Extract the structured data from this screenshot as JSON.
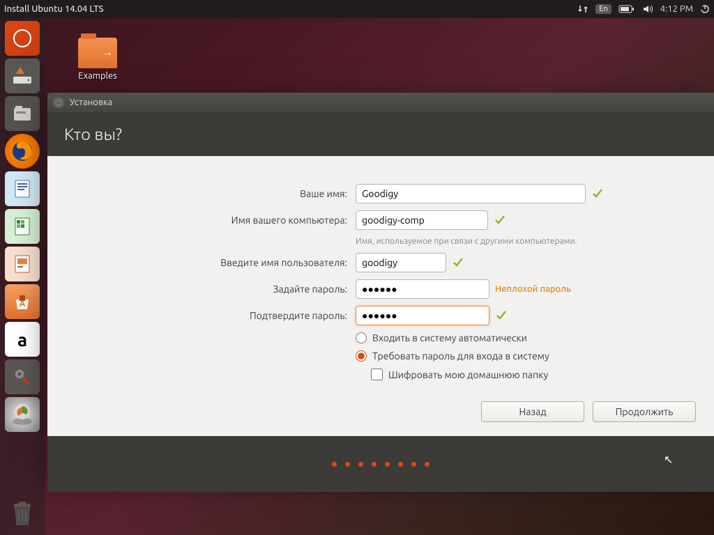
{
  "panel": {
    "title": "Install Ubuntu 14.04 LTS",
    "lang": "En",
    "time": "4:12 PM"
  },
  "desktop": {
    "examples": "Examples"
  },
  "installer": {
    "window_title": "Установка",
    "heading": "Кто вы?",
    "labels": {
      "name": "Ваше имя:",
      "computer": "Имя вашего компьютера:",
      "computer_hint": "Имя, используемое при связи с другими компьютерами.",
      "username": "Введите имя пользователя:",
      "password": "Задайте пароль:",
      "confirm": "Подтвердите пароль:",
      "pw_strength": "Неплохой пароль",
      "auto_login": "Входить в систему автоматически",
      "req_password": "Требовать пароль для входа в систему",
      "encrypt": "Шифровать мою домашнюю папку"
    },
    "values": {
      "name": "Goodigy",
      "computer": "goodigy-comp",
      "username": "goodigy",
      "password": "●●●●●●",
      "confirm": "●●●●●●"
    },
    "buttons": {
      "back": "Назад",
      "continue": "Продолжить"
    }
  }
}
